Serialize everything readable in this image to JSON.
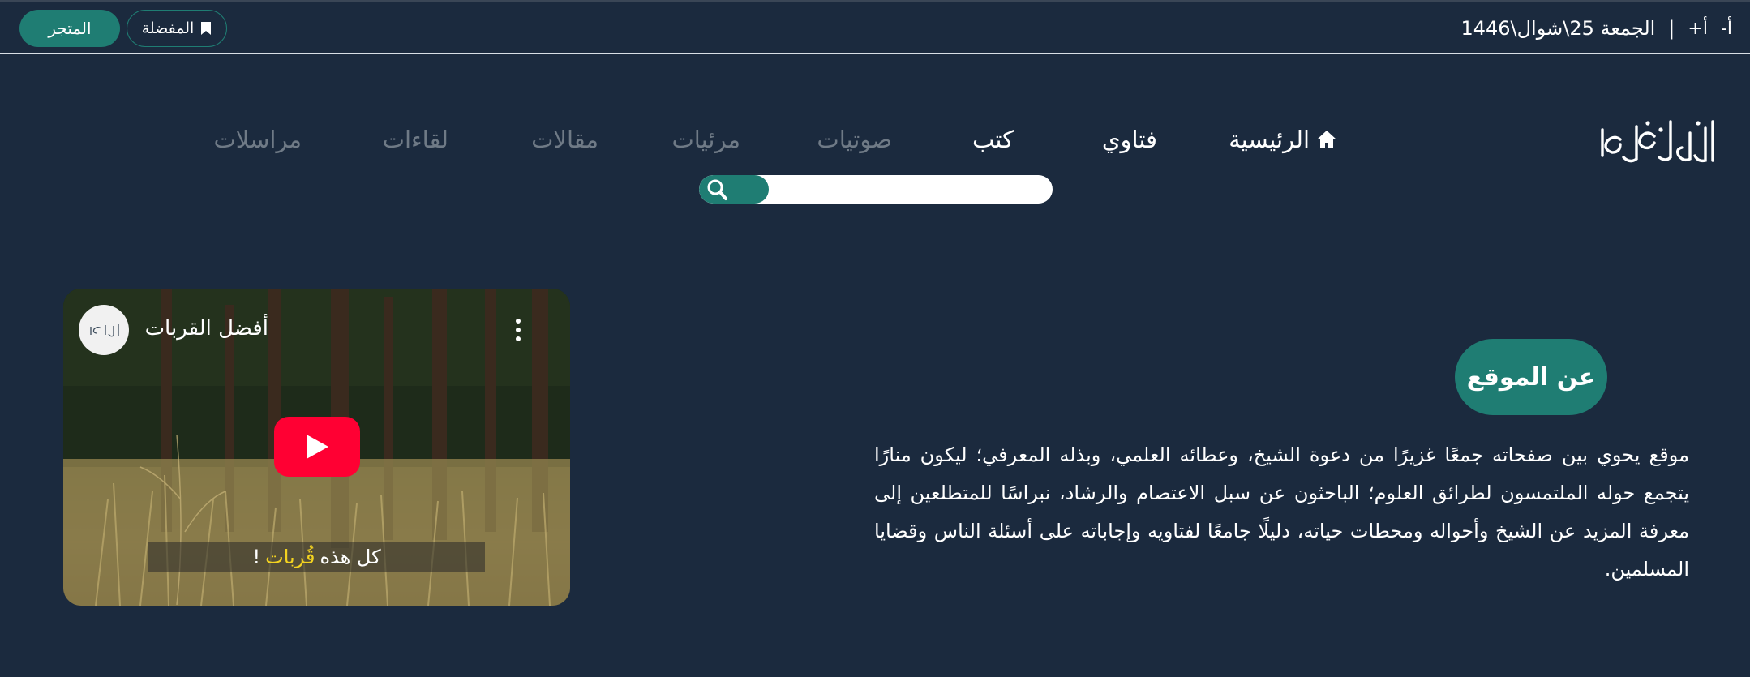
{
  "topbar": {
    "date_text": "الجمعة 25\\شوال\\1446",
    "separator": "|",
    "font_increase": "أ+",
    "font_decrease": "أ-",
    "favorites_label": "المفضلة",
    "store_label": "المتجر"
  },
  "logo": {
    "alt": "الإمام ابن باز"
  },
  "nav": {
    "home": "الرئيسية",
    "fatwas": "فتاوي",
    "books": "كتب",
    "audios": "صوتيات",
    "videos": "مرئيات",
    "articles": "مقالات",
    "meetings": "لقاءات",
    "correspondence": "مراسلات"
  },
  "search": {
    "placeholder": ""
  },
  "about": {
    "title": "عن الموقع",
    "text": "موقع يحوي بين صفحاته جمعًا غزيرًا من دعوة الشيخ، وعطائه العلمي، وبذله المعرفي؛ ليكون منارًا يتجمع حوله الملتمسون لطرائق العلوم؛ الباحثون عن سبل الاعتصام والرشاد، نبراسًا للمتطلعين إلى معرفة المزيد عن الشيخ وأحواله ومحطات حياته، دليلًا جامعًا لفتاويه وإجاباته على أسئلة الناس وقضايا المسلمين."
  },
  "video": {
    "title": "أفضل القربات",
    "caption_prefix": "كل هذه",
    "caption_highlight": "قُربات",
    "caption_suffix": "!"
  },
  "colors": {
    "background": "#1b2a3e",
    "accent": "#1f7d73",
    "youtube_red": "#ff0033",
    "caption_highlight": "#f4d320"
  }
}
